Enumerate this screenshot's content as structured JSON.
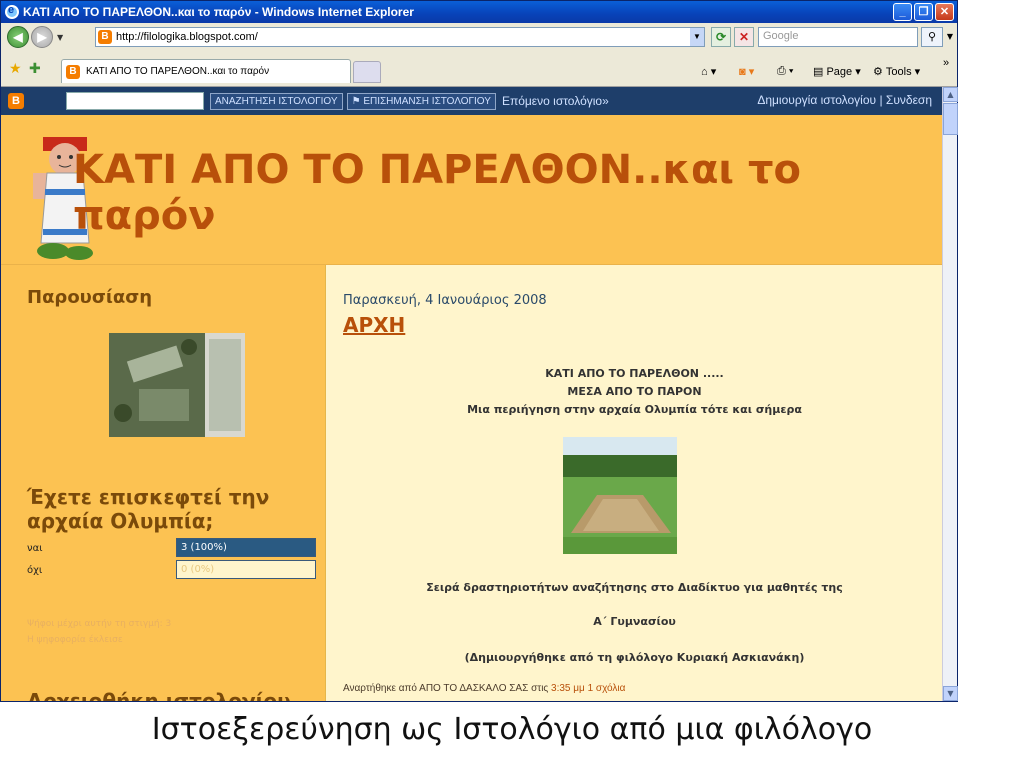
{
  "window": {
    "title": "ΚΑΤΙ ΑΠΟ ΤΟ ΠΑΡΕΛΘΟΝ..και το παρόν - Windows Internet Explorer"
  },
  "address": {
    "url": "http://filologika.blogspot.com/",
    "search_placeholder": "Google"
  },
  "tab": {
    "label": "ΚΑΤΙ ΑΠΟ ΤΟ ΠΑΡΕΛΘΟΝ..και το παρόν"
  },
  "commands": {
    "page": "Page",
    "tools": "Tools"
  },
  "navbar": {
    "search_blog": "ΑΝΑΖΗΤΗΣΗ ΙΣΤΟΛΟΓΙΟΥ",
    "flag_blog": "ΕΠΙΣΗΜΑΝΣΗ ΙΣΤΟΛΟΓΙΟΥ",
    "next_blog": "Επόμενο ιστολόγιο»",
    "create_blog": "Δημιουργία ιστολογίου",
    "separator": "|",
    "login": "Συνδεση"
  },
  "header": {
    "title": "ΚΑΤΙ ΑΠΟ ΤΟ ΠΑΡΕΛΘΟΝ..και το παρόν"
  },
  "sidebar": {
    "presentation_heading": "Παρουσίαση",
    "poll_question": "Έχετε επισκεφτεί την αρχαία Ολυμπία;",
    "poll_options": [
      {
        "label": "ναι",
        "result": "3 (100%)",
        "fraction": 1.0
      },
      {
        "label": "όχι",
        "result": "0 (0%)",
        "fraction": 0.0
      }
    ],
    "votes_text": "Ψήφοι μέχρι αυτήν τη στιγμή: 3",
    "poll_closed": "Η ψηφοφορία έκλεισε",
    "archive_heading": "Αρχειοθήκη ιστολογίου"
  },
  "post": {
    "date": "Παρασκευή, 4 Ιανουάριος 2008",
    "title": "ΑΡΧΗ",
    "line1": "ΚΑΤΙ ΑΠΟ ΤΟ ΠΑΡΕΛΘΟΝ .....",
    "line2": "ΜΕΣΑ ΑΠΟ ΤΟ ΠΑΡΟΝ",
    "line3": "Μια περιήγηση στην αρχαία Ολυμπία τότε και σήμερα",
    "line4": "Σειρά δραστηριοτήτων αναζήτησης στο Διαδίκτυο για μαθητές της",
    "line5": "Α΄ Γυμνασίου",
    "line6": "(Δημιουργήθηκε από τη φιλόλογο Κυριακή Ασκιανάκη)",
    "footer_prefix": "Αναρτήθηκε από ΑΠΟ ΤΟ ΔΑΣΚΑΛΟ ΣΑΣ στις",
    "footer_time": "3:35 μμ",
    "footer_comments": "1 σχόλια"
  },
  "caption": "Ιστοεξερεύνηση ως Ιστολόγιο από μια φιλόλογο"
}
